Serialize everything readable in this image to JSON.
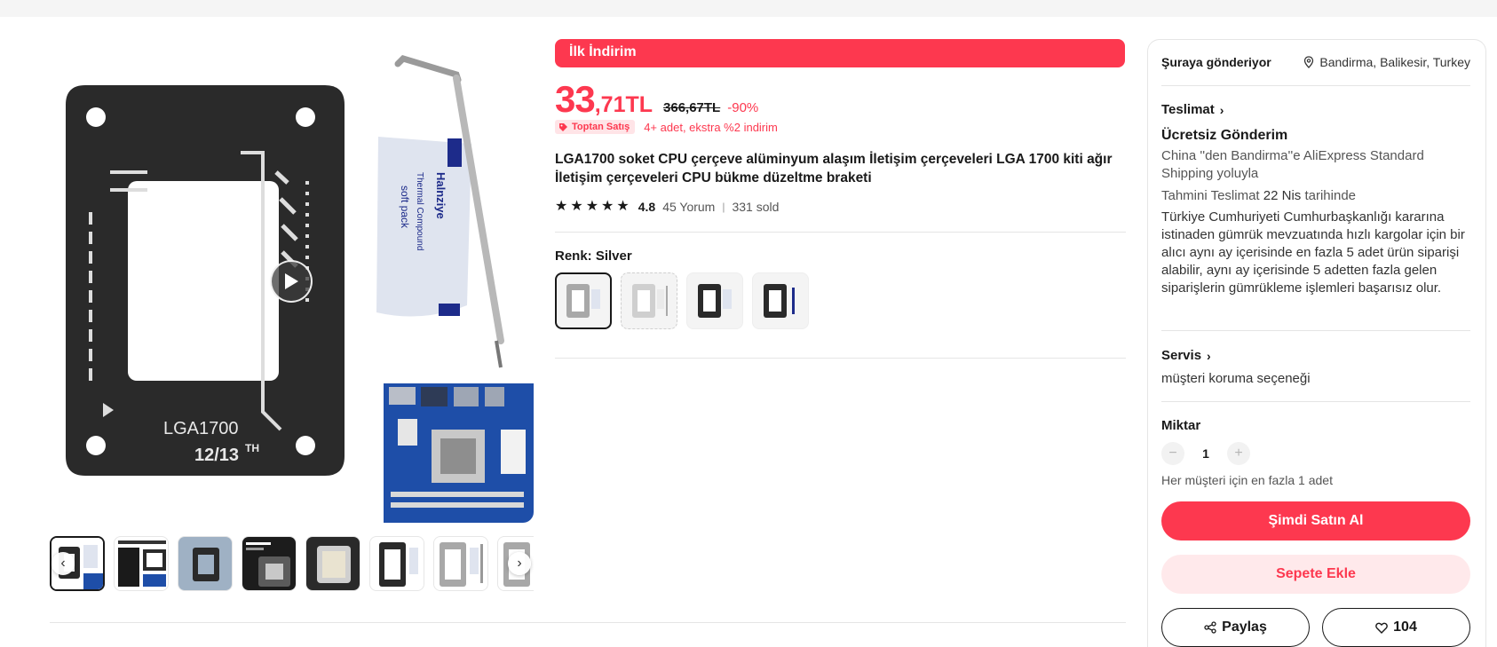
{
  "promo": {
    "label": "İlk İndirim"
  },
  "price": {
    "integer": "33",
    "decimal": ",71TL",
    "original": "366,67TL",
    "discount": "-90%"
  },
  "bulk": {
    "badge": "Toptan Satış",
    "text": "4+ adet, ekstra %2 indirim"
  },
  "product": {
    "title": "LGA1700 soket CPU çerçeve alüminyum alaşım İletişim çerçeveleri LGA 1700 kiti ağır İletişim çerçeveleri CPU bükme düzeltme braketi",
    "rating": "4.8",
    "reviews": "45 Yorum",
    "sold": "331 sold"
  },
  "main_image": {
    "frame_text": "LGA1700",
    "frame_sub": "12/13",
    "frame_sup": "TH",
    "pack_brand": "Halnziye",
    "pack_line1": "Thermal Compound",
    "pack_line2": "soft pack"
  },
  "thumbnails": {
    "count": 8,
    "prev_icon": "chevron-left-icon",
    "next_icon": "chevron-right-icon"
  },
  "color": {
    "label": "Renk: Silver",
    "options": [
      "silver",
      "silver-light",
      "black",
      "black-alt"
    ],
    "selected": 0
  },
  "shipping": {
    "label": "Şuraya gönderiyor",
    "location": "Bandirma, Balikesir, Turkey"
  },
  "delivery": {
    "title": "Teslimat",
    "free": "Ücretsiz Gönderim",
    "via": "China ''den Bandirma''e AliExpress Standard Shipping yoluyla",
    "estimate_prefix": "Tahmini Teslimat ",
    "estimate_date": "22 Nis",
    "estimate_suffix": " tarihinde",
    "notice": "Türkiye Cumhuriyeti Cumhurbaşkanlığı kararına istinaden gümrük mevzuatında hızlı kargolar için bir alıcı aynı ay içerisinde en fazla 5 adet ürün siparişi alabilir, aynı ay içerisinde 5 adetten fazla gelen siparişlerin gümrükleme işlemleri başarısız olur."
  },
  "service": {
    "title": "Servis",
    "text": "müşteri koruma seçeneği"
  },
  "quantity": {
    "title": "Miktar",
    "value": "1",
    "minus": "−",
    "plus": "+",
    "limit": "Her müşteri için en fazla 1 adet"
  },
  "actions": {
    "buy": "Şimdi Satın Al",
    "cart": "Sepete Ekle",
    "share": "Paylaş",
    "wishlist_count": "104"
  },
  "colors": {
    "accent": "#fd384f",
    "accent_light": "#ffe9eb",
    "text": "#191919"
  }
}
